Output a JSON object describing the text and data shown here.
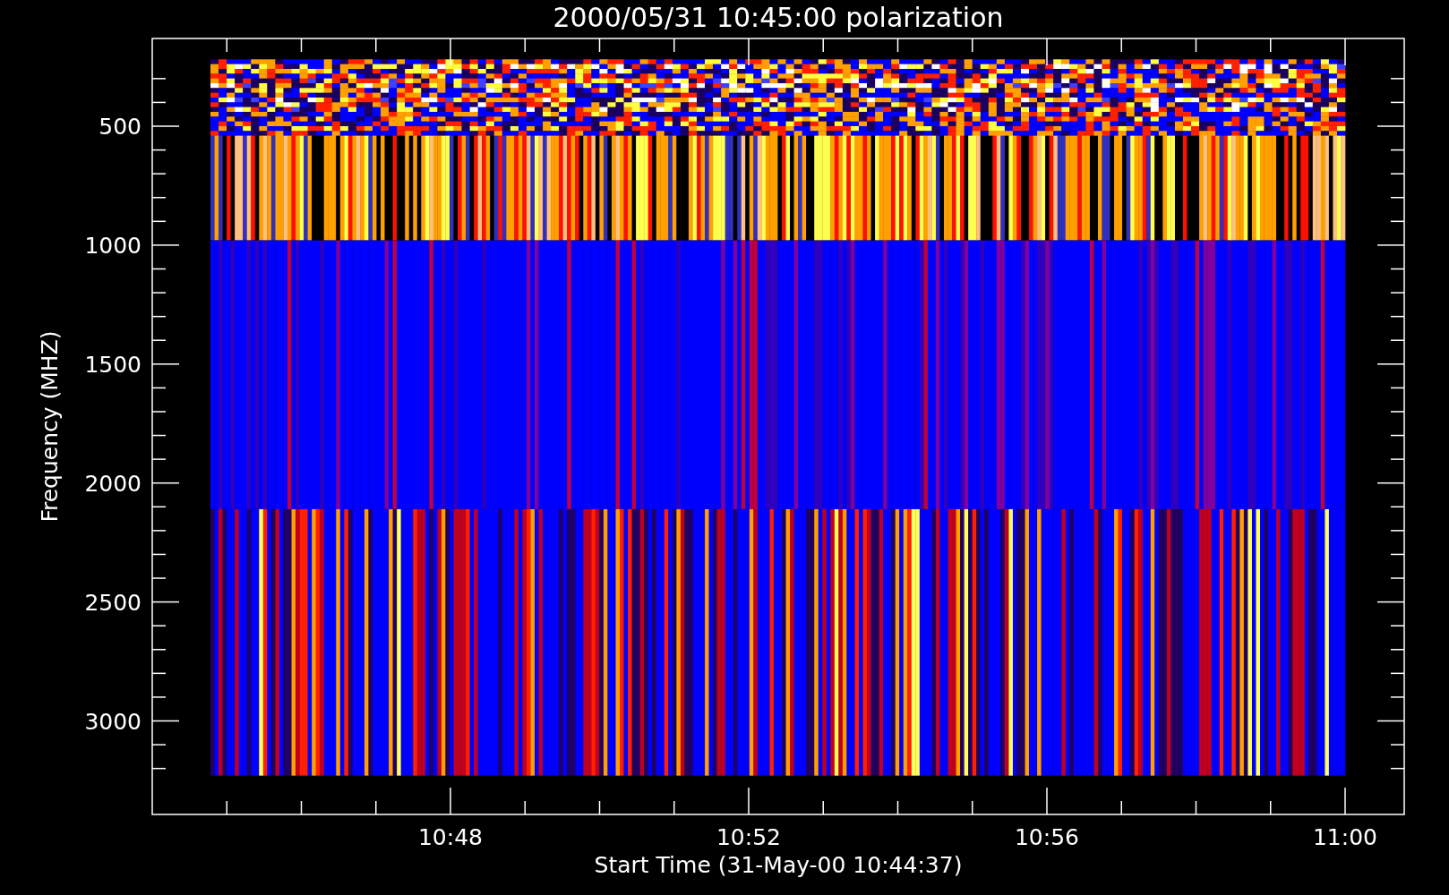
{
  "title": "2000/05/31 10:45:00 polarization",
  "y_axis": {
    "label": "Frequency (MHZ)",
    "ticks": [
      "500",
      "1000",
      "1500",
      "2000",
      "2500",
      "3000"
    ]
  },
  "x_axis": {
    "label": "Start Time (31-May-00 10:44:37)",
    "ticks": [
      "10:48",
      "10:52",
      "10:56",
      "11:00"
    ]
  }
}
